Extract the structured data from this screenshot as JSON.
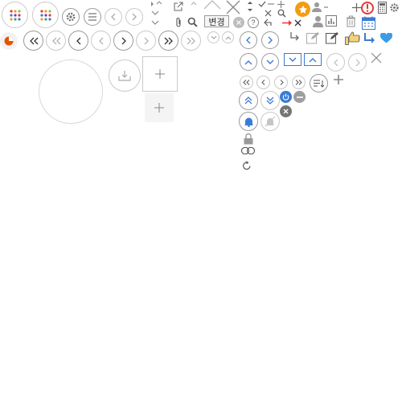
{
  "toolbar": {
    "change_label": "변경"
  },
  "colors": {
    "accent_blue": "#3a7bd5",
    "orange": "#f39c12",
    "red": "#e53935",
    "icon_gray": "#8c8c8c",
    "border_gray": "#c9c9c9"
  },
  "icons": [
    "apps-grid-icon",
    "apps-grid-icon",
    "gear-icon",
    "menu-icon",
    "chevron-left-icon",
    "chevron-right-icon",
    "expand-arrows-icon",
    "external-link-icon",
    "close-icon",
    "sort-icon",
    "search-icon",
    "star-badge-icon",
    "user-remove-icon",
    "add-icon",
    "alert-icon",
    "calculator-icon",
    "settings-icon",
    "paperclip-icon",
    "help-icon",
    "user-icon",
    "chart-icon",
    "trash-icon",
    "calendar-icon",
    "pie-chart-icon",
    "double-chevron-left-icon",
    "chevron-down-circle-icon",
    "chevron-up-circle-icon",
    "return-arrow-icon",
    "edit-icon",
    "thumbs-up-icon",
    "heart-icon",
    "download-icon",
    "plus-icon",
    "power-icon",
    "minus-icon",
    "bell-icon",
    "bell-off-icon",
    "lock-icon",
    "link-icon",
    "refresh-icon",
    "sort-list-icon"
  ]
}
